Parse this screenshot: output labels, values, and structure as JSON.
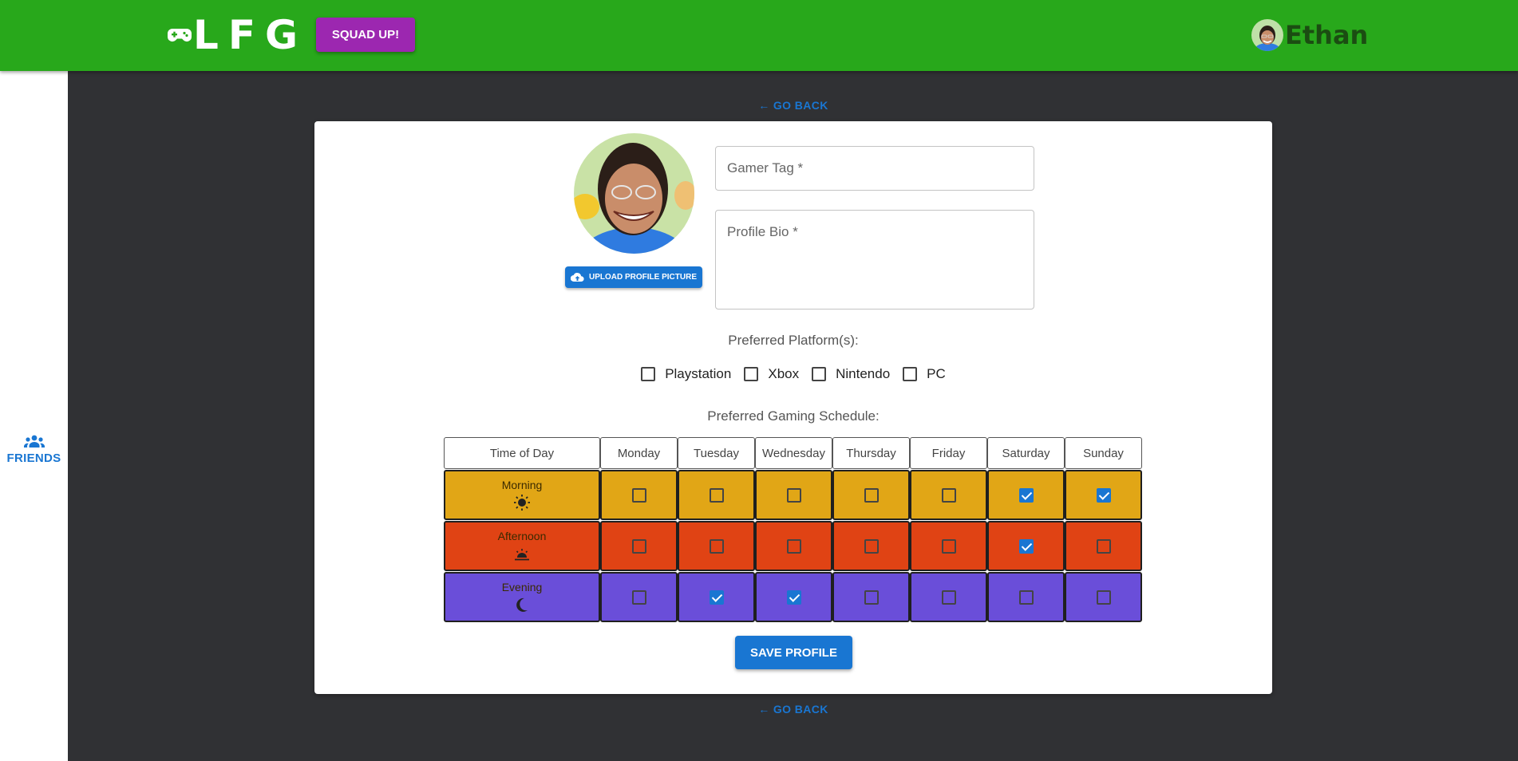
{
  "header": {
    "logo_text": "LFG",
    "logo_icon": "gamepad-icon",
    "squad_up_label": "SQUAD UP!",
    "user_name": "Ethan",
    "brand_color": "#28a81b"
  },
  "sidebar": {
    "friends_label": "FRIENDS",
    "friends_icon": "people-icon"
  },
  "nav": {
    "go_back_top": "← GO BACK",
    "go_back_bottom": "← GO BACK"
  },
  "profile": {
    "upload_label": "UPLOAD PROFILE PICTURE",
    "upload_icon": "cloud-upload-icon",
    "gamer_tag": {
      "placeholder": "Gamer Tag *",
      "value": ""
    },
    "bio": {
      "placeholder": "Profile Bio *",
      "value": ""
    }
  },
  "platforms": {
    "label": "Preferred Platform(s):",
    "options": [
      {
        "label": "Playstation",
        "checked": false
      },
      {
        "label": "Xbox",
        "checked": false
      },
      {
        "label": "Nintendo",
        "checked": false
      },
      {
        "label": "PC",
        "checked": false
      }
    ]
  },
  "schedule": {
    "label": "Preferred Gaming Schedule:",
    "header_first": "Time of Day",
    "days": [
      "Monday",
      "Tuesday",
      "Wednesday",
      "Thursday",
      "Friday",
      "Saturday",
      "Sunday"
    ],
    "slots": [
      {
        "label": "Morning",
        "icon": "sun-icon",
        "color": "#e1a616",
        "checks": [
          false,
          false,
          false,
          false,
          false,
          true,
          true
        ]
      },
      {
        "label": "Afternoon",
        "icon": "sunset-icon",
        "color": "#e04314",
        "checks": [
          false,
          false,
          false,
          false,
          false,
          true,
          false
        ]
      },
      {
        "label": "Evening",
        "icon": "moon-icon",
        "color": "#6a4ed9",
        "checks": [
          false,
          true,
          true,
          false,
          false,
          false,
          false
        ]
      }
    ]
  },
  "save_label": "SAVE PROFILE",
  "accent_color": "#1976d2"
}
